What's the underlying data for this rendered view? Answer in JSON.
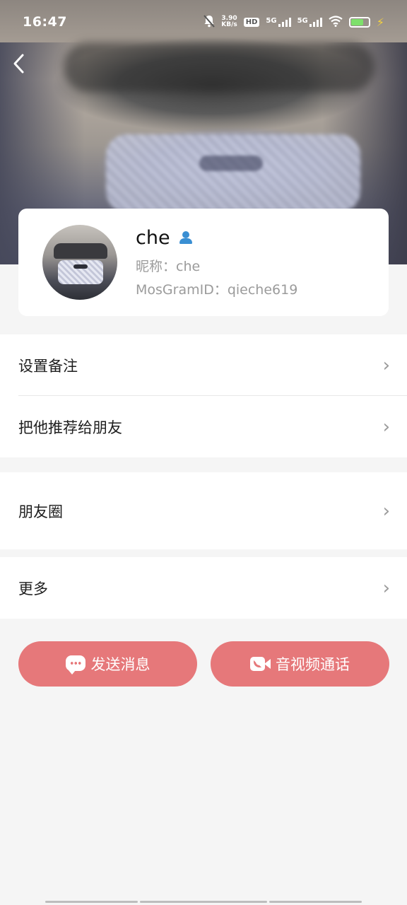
{
  "status_bar": {
    "time": "16:47",
    "net_speed_top": "3.90",
    "net_speed_bottom": "KB/s",
    "hd_label": "HD",
    "signal_1": "5G",
    "signal_2": "5G",
    "battery_level": 0.7,
    "battery_color": "#7ee06b"
  },
  "header": {
    "back_icon": "chevron-left-icon"
  },
  "profile": {
    "name": "che",
    "verified_icon": "person-icon",
    "nickname_line": "昵称：che",
    "id_line": "MosGramID：qieche619"
  },
  "menu": {
    "group1": [
      {
        "label": "设置备注"
      },
      {
        "label": "把他推荐给朋友"
      }
    ],
    "group2": [
      {
        "label": "朋友圈"
      }
    ],
    "group3": [
      {
        "label": "更多"
      }
    ],
    "chevron": "›"
  },
  "actions": {
    "send_message": "发送消息",
    "av_call": "音视频通话",
    "button_color": "#e6787a"
  },
  "colors": {
    "background": "#f5f5f5",
    "accent": "#e6787a",
    "verified": "#3a8fd3"
  }
}
